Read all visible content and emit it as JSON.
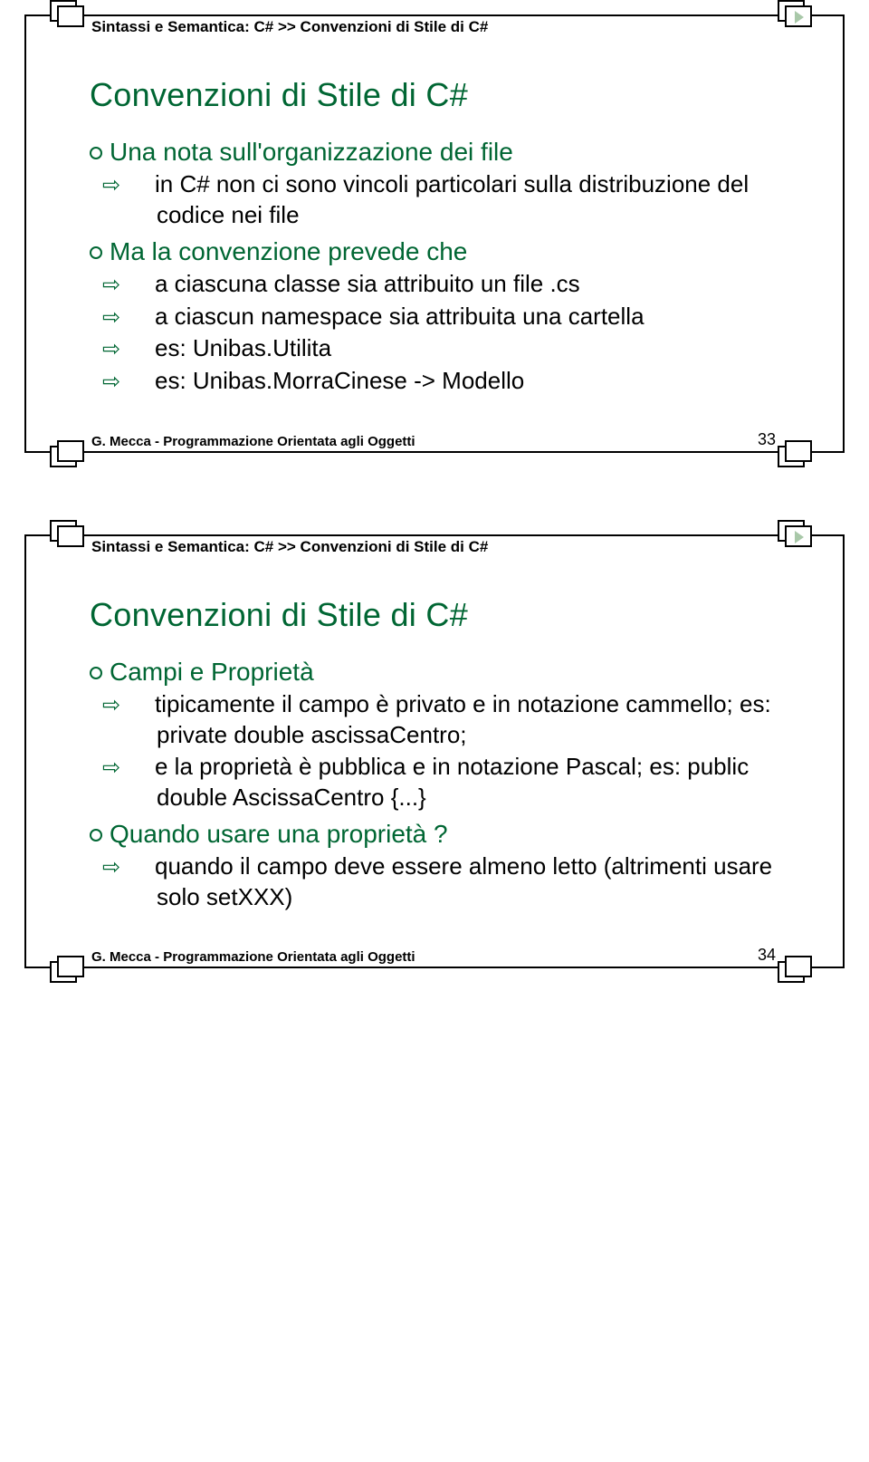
{
  "common": {
    "breadcrumb": "Sintassi e Semantica: C# >> Convenzioni di Stile di C#",
    "footer": "G. Mecca - Programmazione Orientata agli Oggetti",
    "slide_title": "Convenzioni di Stile di C#"
  },
  "slide1": {
    "page_num": "33",
    "bul1": "Una nota sull'organizzazione dei file",
    "sub1a": "in C# non ci sono vincoli particolari sulla distribuzione del codice nei file",
    "bul2": "Ma la convenzione prevede che",
    "sub2a": "a ciascuna classe sia attribuito un file .cs",
    "sub2b": "a ciascun namespace sia attribuita una cartella",
    "sub2c": "es: Unibas.Utilita",
    "sub2d": "es: Unibas.MorraCinese -> Modello"
  },
  "slide2": {
    "page_num": "34",
    "bul1": "Campi e Proprietà",
    "sub1a": "tipicamente il campo è privato e in notazione cammello; es: private double ascissaCentro;",
    "sub1b": "e la proprietà è pubblica e in notazione Pascal; es: public double AscissaCentro {...}",
    "bul2": "Quando usare una proprietà ?",
    "sub2a": "quando il campo deve essere almeno letto (altrimenti usare solo setXXX)"
  }
}
